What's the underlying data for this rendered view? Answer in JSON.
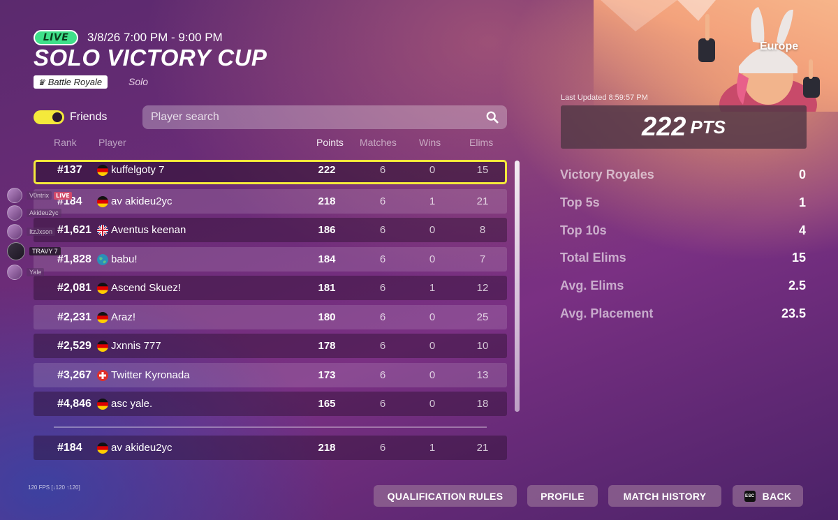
{
  "header": {
    "live_label": "LIVE",
    "datetime": "3/8/26 7:00 PM - 9:00 PM",
    "title": "SOLO VICTORY CUP",
    "mode": "Battle Royale",
    "mode_sub": "Solo"
  },
  "filters": {
    "friends_label": "Friends",
    "friends_on": true,
    "search_placeholder": "Player search"
  },
  "table": {
    "columns": {
      "rank": "Rank",
      "player": "Player",
      "points": "Points",
      "matches": "Matches",
      "wins": "Wins",
      "elims": "Elims"
    },
    "rows": [
      {
        "rank": "#137",
        "flag": "de",
        "player": "kuffelgoty 7",
        "points": "222",
        "matches": "6",
        "wins": "0",
        "elims": "15"
      },
      {
        "rank": "#184",
        "flag": "de",
        "player": "av akideu2yc",
        "points": "218",
        "matches": "6",
        "wins": "1",
        "elims": "21"
      },
      {
        "rank": "#1,621",
        "flag": "gb",
        "player": "Aventus keenan",
        "points": "186",
        "matches": "6",
        "wins": "0",
        "elims": "8"
      },
      {
        "rank": "#1,828",
        "flag": "globe",
        "player": "babu!",
        "points": "184",
        "matches": "6",
        "wins": "0",
        "elims": "7"
      },
      {
        "rank": "#2,081",
        "flag": "de",
        "player": "Ascend Skuez!",
        "points": "181",
        "matches": "6",
        "wins": "1",
        "elims": "12"
      },
      {
        "rank": "#2,231",
        "flag": "de",
        "player": "Araz!",
        "points": "180",
        "matches": "6",
        "wins": "0",
        "elims": "25"
      },
      {
        "rank": "#2,529",
        "flag": "de",
        "player": "Jxnnis 777",
        "points": "178",
        "matches": "6",
        "wins": "0",
        "elims": "10"
      },
      {
        "rank": "#3,267",
        "flag": "ch",
        "player": "Twitter Kyronada",
        "points": "173",
        "matches": "6",
        "wins": "0",
        "elims": "13"
      },
      {
        "rank": "#4,846",
        "flag": "de",
        "player": "asc yale.",
        "points": "165",
        "matches": "6",
        "wins": "0",
        "elims": "18"
      }
    ],
    "pinned": {
      "rank": "#184",
      "flag": "de",
      "player": "av akideu2yc",
      "points": "218",
      "matches": "6",
      "wins": "1",
      "elims": "21"
    }
  },
  "friends": [
    {
      "name": "V0ntrix",
      "live": "LIVE"
    },
    {
      "name": "Akideu2yc",
      "live": ""
    },
    {
      "name": "ItzJxson",
      "live": ""
    },
    {
      "name": "TRAVY 7",
      "live": ""
    },
    {
      "name": "Yale",
      "live": ""
    }
  ],
  "panel": {
    "region": "Europe",
    "last_updated": "Last Updated 8:59:57 PM",
    "points_value": "222",
    "points_unit": "PTS",
    "stats": [
      {
        "label": "Victory Royales",
        "value": "0"
      },
      {
        "label": "Top 5s",
        "value": "1"
      },
      {
        "label": "Top 10s",
        "value": "4"
      },
      {
        "label": "Total Elims",
        "value": "15"
      },
      {
        "label": "Avg. Elims",
        "value": "2.5"
      },
      {
        "label": "Avg. Placement",
        "value": "23.5"
      }
    ]
  },
  "footer": {
    "fps": "120 FPS [↓120 ↑120]",
    "qualification": "QUALIFICATION RULES",
    "profile": "PROFILE",
    "match_history": "MATCH HISTORY",
    "esc_key": "ESC",
    "back": "BACK"
  },
  "colors": {
    "accent_yellow": "#f4e93b",
    "live_green": "#3fe08a",
    "live_badge": "#d14a6b"
  }
}
